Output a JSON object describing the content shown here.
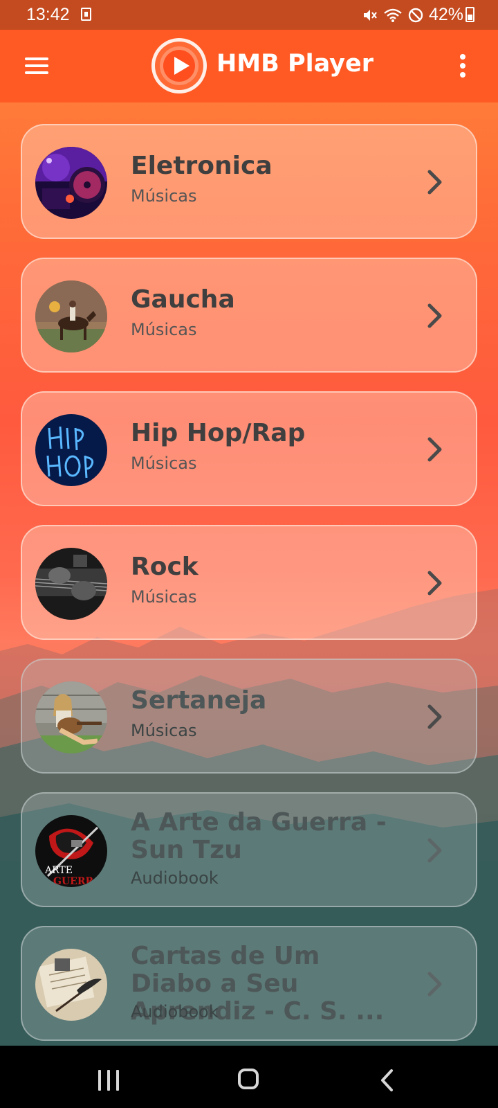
{
  "status_bar": {
    "time": "13:42",
    "battery_text": "42%",
    "battery_level": 0.42,
    "icons": [
      "sim-card-icon",
      "mute-icon",
      "wifi-icon",
      "do-not-disturb-icon",
      "battery-icon"
    ]
  },
  "app_bar": {
    "title": "HMB Player",
    "icons": [
      "menu-icon",
      "play-logo-icon",
      "more-vert-icon"
    ]
  },
  "categories": [
    {
      "title": "Eletronica",
      "subtitle": "Músicas",
      "thumbnail": "dj-turntable-image"
    },
    {
      "title": "Gaucha",
      "subtitle": "Músicas",
      "thumbnail": "horse-rider-image"
    },
    {
      "title": "Hip Hop/Rap",
      "subtitle": "Músicas",
      "thumbnail": "neon-hiphop-image"
    },
    {
      "title": "Rock",
      "subtitle": "Músicas",
      "thumbnail": "guitar-image"
    },
    {
      "title": "Sertaneja",
      "subtitle": "Músicas",
      "thumbnail": "guitar-girl-image"
    },
    {
      "title": "A Arte da Guerra - Sun Tzu",
      "subtitle": "Audiobook",
      "thumbnail": "arte-da-guerra-image"
    },
    {
      "title": "Cartas de Um Diabo a Seu Aprendiz - C. S. ...",
      "subtitle": "Audiobook",
      "thumbnail": "letters-quill-image"
    }
  ],
  "nav_bar": {
    "icons": [
      "recent-apps-icon",
      "home-icon",
      "back-icon"
    ]
  },
  "colors": {
    "status_bar": "#c44a1f",
    "app_bar": "#ff5a24",
    "card_text": "#3f3f3f"
  }
}
